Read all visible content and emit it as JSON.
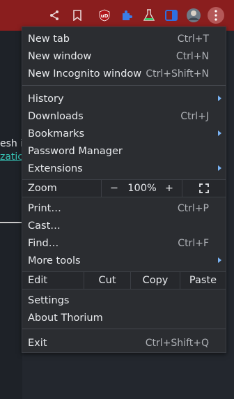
{
  "toolbar": {
    "icons": [
      "share-icon",
      "bookmark-icon",
      "ublock-origin-icon",
      "extensions-puzzle-icon",
      "lab-flask-icon",
      "side-panel-icon",
      "profile-avatar",
      "menu-kebab-icon"
    ],
    "ublock_text": "uD"
  },
  "background": {
    "fragment_1": "esh i",
    "fragment_2": "zatic"
  },
  "menu": {
    "new_tab": {
      "label": "New tab",
      "shortcut": "Ctrl+T"
    },
    "new_window": {
      "label": "New window",
      "shortcut": "Ctrl+N"
    },
    "new_incognito": {
      "label": "New Incognito window",
      "shortcut": "Ctrl+Shift+N"
    },
    "history": {
      "label": "History"
    },
    "downloads": {
      "label": "Downloads",
      "shortcut": "Ctrl+J"
    },
    "bookmarks": {
      "label": "Bookmarks"
    },
    "password_manager": {
      "label": "Password Manager"
    },
    "extensions": {
      "label": "Extensions"
    },
    "zoom": {
      "label": "Zoom",
      "minus": "−",
      "value": "100%",
      "plus": "+"
    },
    "print": {
      "label": "Print…",
      "shortcut": "Ctrl+P"
    },
    "cast": {
      "label": "Cast…"
    },
    "find": {
      "label": "Find…",
      "shortcut": "Ctrl+F"
    },
    "more_tools": {
      "label": "More tools"
    },
    "edit": {
      "label": "Edit",
      "cut": "Cut",
      "copy": "Copy",
      "paste": "Paste"
    },
    "settings": {
      "label": "Settings"
    },
    "about": {
      "label": "About Thorium"
    },
    "exit": {
      "label": "Exit",
      "shortcut": "Ctrl+Shift+Q"
    }
  },
  "colors": {
    "toolbar_bg": "#8a1e1e",
    "menu_bg": "#2b2d31",
    "submenu_arrow": "#7ab4f5",
    "link": "#36c2b4"
  }
}
